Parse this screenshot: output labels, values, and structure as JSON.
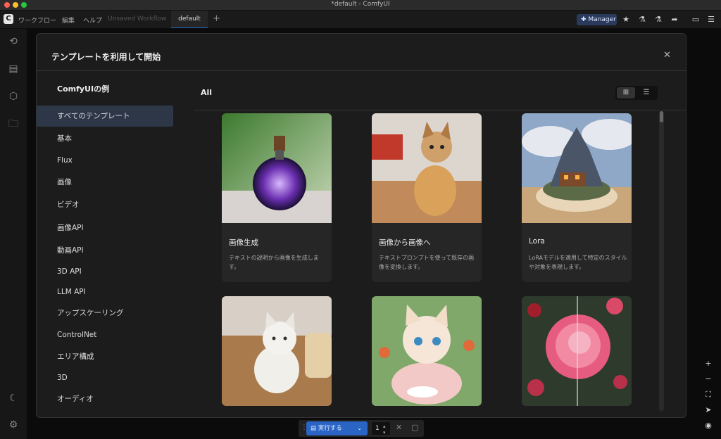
{
  "window": {
    "title": "*default - ComfyUI"
  },
  "menubar": {
    "logo": "C",
    "items": [
      "ワークフロー",
      "編集",
      "ヘルプ"
    ],
    "tabs": [
      "Unsaved Workflow",
      "default"
    ],
    "add_tab": "+",
    "manager_label": "Manager"
  },
  "modal": {
    "title": "テンプレートを利用して開始",
    "nav_title": "ComfyUIの例",
    "nav_items": [
      "すべてのテンプレート",
      "基本",
      "Flux",
      "画像",
      "ビデオ",
      "画像API",
      "動画API",
      "3D API",
      "LLM API",
      "アップスケーリング",
      "ControlNet",
      "エリア構成",
      "3D",
      "オーディオ"
    ],
    "content_title": "All",
    "cards": [
      {
        "title": "画像生成",
        "description": "テキストの説明から画像を生成します。"
      },
      {
        "title": "画像から画像へ",
        "description": "テキストプロンプトを使って既存の画像を変換します。"
      },
      {
        "title": "Lora",
        "description": "LoRAモデルを適用して特定のスタイルや対象を表現します。"
      },
      {
        "title": "",
        "description": ""
      },
      {
        "title": "",
        "description": ""
      },
      {
        "title": "",
        "description": ""
      }
    ]
  },
  "bottom": {
    "run_label": "実行する",
    "count": "1"
  },
  "colors": {
    "accent": "#2a64c4",
    "active_nav": "#2d3748",
    "modal_bg": "#1c1c1c"
  }
}
